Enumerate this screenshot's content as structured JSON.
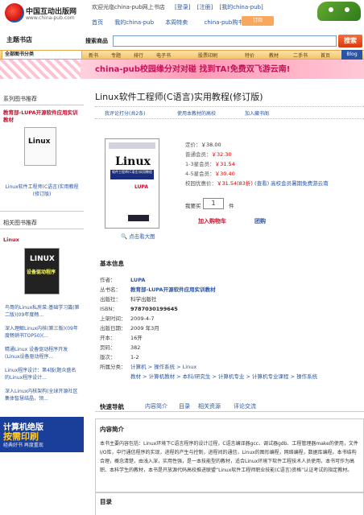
{
  "header": {
    "logo_cn": "中国互动出版网",
    "logo_en": "www.china-pub.com",
    "welcome_text": "欢迎光临china-pub网上书店",
    "login": "[登录]",
    "register": "[注册]",
    "my_chinapub": "[我的china-pub]",
    "nav": [
      "首页",
      "我的china-pub",
      "本周特卖",
      "china-pub购书卡"
    ],
    "badge": "订阅"
  },
  "search": {
    "theme_shop": "主题书店",
    "label": "搜索商品",
    "value": "",
    "button": "搜索"
  },
  "categories": {
    "all": "全部图书分类",
    "items": [
      "新书",
      "专题",
      "排行",
      "电子书",
      "股票印刷",
      "特价",
      "教材",
      "二手书",
      "首页"
    ],
    "blog": "Blog"
  },
  "banner": {
    "text": "china-pub校园缘分对对碰 找到TA!免费双飞游云南!"
  },
  "sidebar": {
    "series_heading": "系列图书推荐",
    "series_name": "教育部-LUPA开源软件应用实训教材",
    "series_book_cover_word": "Linux",
    "series_book_link": "Linux软件工程师(C语言)实用教程(修订版)",
    "related_heading": "相关图书推荐",
    "related_label": "Linux",
    "related_cover_word": "LINUX",
    "related_cover_sub": "设备驱动程序",
    "related_links": [
      "鸟哥的Linux私房菜:基础学习篇(第二版)(09年度畅...",
      "深入理解Linux内核(第三版)(09年度畅销书TOP50)(...",
      "精通Linux 设备驱动程序开发(Linux设备驱动程序...",
      "Linux程序设计：第4版(题众盛名的Linux程序设计...",
      "深入Linux内核架构(全球开源社区集体智慧结晶，领..."
    ],
    "ad_line1": "计算机绝版",
    "ad_line2": "按需印刷",
    "ad_line3": "经典好书 再度重现"
  },
  "product": {
    "title": "Linux软件工程师(C语言)实用教程(修订版)",
    "actions": [
      "我评论打分(共2条)",
      "使用本教材的高校",
      "加入藏书阁"
    ],
    "cover_word": "Linux",
    "cover_sub": "软件工程师(C语言)实用教程",
    "cover_badge": "LUPA",
    "zoom_link": "点击看大图",
    "prices": [
      {
        "label": "定价：",
        "value": "￥38.00",
        "extra": ""
      },
      {
        "label": "普通会员：",
        "value": "￥32.30",
        "extra": ""
      },
      {
        "label": "1-3星会员：",
        "value": "￥31.54",
        "extra": ""
      },
      {
        "label": "4-5星会员：",
        "value": "￥30.40",
        "extra": ""
      },
      {
        "label": "校园优惠价：",
        "value": "￥31.54(83折)",
        "extra": "(查看) 高校会员暑期免费游云南"
      }
    ],
    "qty_label": "我要买",
    "qty_value": "1",
    "qty_unit": "件",
    "buy_button": "加入购物车",
    "group_button": "团购"
  },
  "basic_info": {
    "heading": "基本信息",
    "rows": [
      {
        "key": "作者：",
        "value": "LUPA"
      },
      {
        "key": "丛书名：",
        "value": "教育部-LUPA开源软件应用实训教材"
      },
      {
        "key": "出版社：",
        "value": "科学出版社"
      },
      {
        "key": "ISBN：",
        "value": "9787030199645"
      },
      {
        "key": "上架时间：",
        "value": "2009-4-7"
      },
      {
        "key": "出版日期：",
        "value": "2009 年3月"
      },
      {
        "key": "开本：",
        "value": "16开"
      },
      {
        "key": "页码：",
        "value": "382"
      },
      {
        "key": "版次：",
        "value": "1-2"
      }
    ],
    "category_key": "所属分类：",
    "category_line1": "计算机 > 操作系统 > Linux",
    "category_line2": "教材 > 计算机教材 > 本科/研究生 > 计算机专业 > 计算机专业课程 > 操作系统"
  },
  "guide": {
    "title": "快速导航",
    "items": [
      "内容简介",
      "目录",
      "相关资源",
      "评论交流"
    ]
  },
  "intro": {
    "heading": "内容简介",
    "text": "本书主要内容包括：Linux环境下C语言程序的设计过程，C语言编译器gcc、调试器gdb、工程管理器make的使用，文件I/O库，中行通信程序的实现，进程的产生与控制，进程间的通信，Linux的图形编程，网络编程，数据库编程。本书结构合理，概念清楚，由浅入深，实用性强，是一本技能型的教材，适合Linux环境下软件工程技术人员使用，本书可作为高职、本科学生的教材，本书是开放源代码高校推进联盟“Linux软件工程师职业技能(C语言)资格”认证考试的指定教材。"
  },
  "toc": {
    "heading": "目录"
  }
}
